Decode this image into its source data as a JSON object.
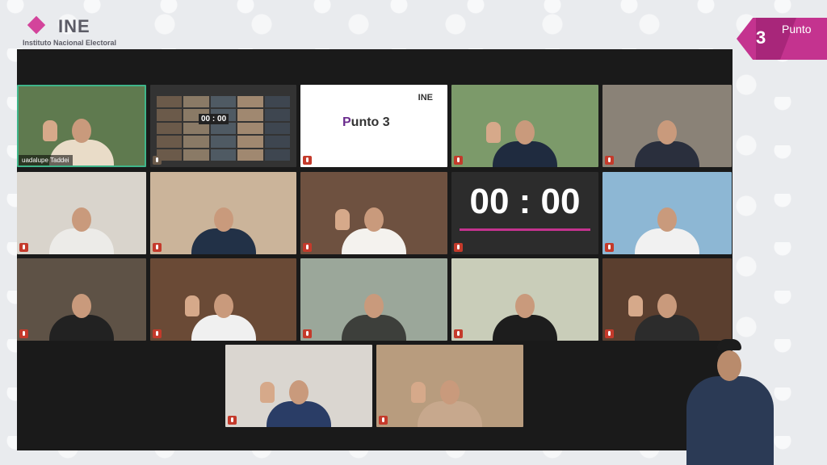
{
  "branding": {
    "logo_text": "INE",
    "logo_subtitle": "Instituto Nacional Electoral",
    "badge_number": "3",
    "badge_label": "Punto"
  },
  "participants": [
    {
      "id": "p1",
      "name": "uadalupe Taddei",
      "bg": "#5f7a4f",
      "torso": "#e9dcc8",
      "hand": true
    },
    {
      "id": "p2",
      "type": "gallery",
      "timer": "00 : 00"
    },
    {
      "id": "p3",
      "type": "slide",
      "brand": "INE",
      "title_letter": "P",
      "title_rest": "unto 3"
    },
    {
      "id": "p4",
      "bg": "#7c9a6a",
      "torso": "#1f2b3f",
      "hand": true
    },
    {
      "id": "p5",
      "bg": "#8a8277",
      "torso": "#2a2f3d"
    },
    {
      "id": "p6",
      "bg": "#d9d4cc",
      "torso": "#ecebe8"
    },
    {
      "id": "p7",
      "bg": "#cbb49a",
      "torso": "#223147"
    },
    {
      "id": "p8",
      "bg": "#6e5140",
      "torso": "#f4f2ee",
      "hand": true
    },
    {
      "id": "p9",
      "type": "timer",
      "timer": "00 : 00"
    },
    {
      "id": "p10",
      "bg": "#8db7d4",
      "torso": "#f1f1f1"
    },
    {
      "id": "p11",
      "bg": "#5e5246",
      "torso": "#222"
    },
    {
      "id": "p12",
      "bg": "#6a4a36",
      "torso": "#f0f0f0",
      "hand": true
    },
    {
      "id": "p13",
      "bg": "#9ba79a",
      "torso": "#3d3f3b"
    },
    {
      "id": "p14",
      "bg": "#c9cdb9",
      "torso": "#1d1d1d"
    },
    {
      "id": "p15",
      "bg": "#5b3f2f",
      "torso": "#2c2c2c",
      "hand": true
    },
    {
      "id": "p16",
      "bg": "#dad6d0",
      "torso": "#2a3d66",
      "hand": true
    },
    {
      "id": "p17",
      "bg": "#b89c7e",
      "torso": "#c7a88d",
      "hand": true
    }
  ],
  "colors": {
    "accent": "#c4338f",
    "frame": "#1a1a1a"
  }
}
